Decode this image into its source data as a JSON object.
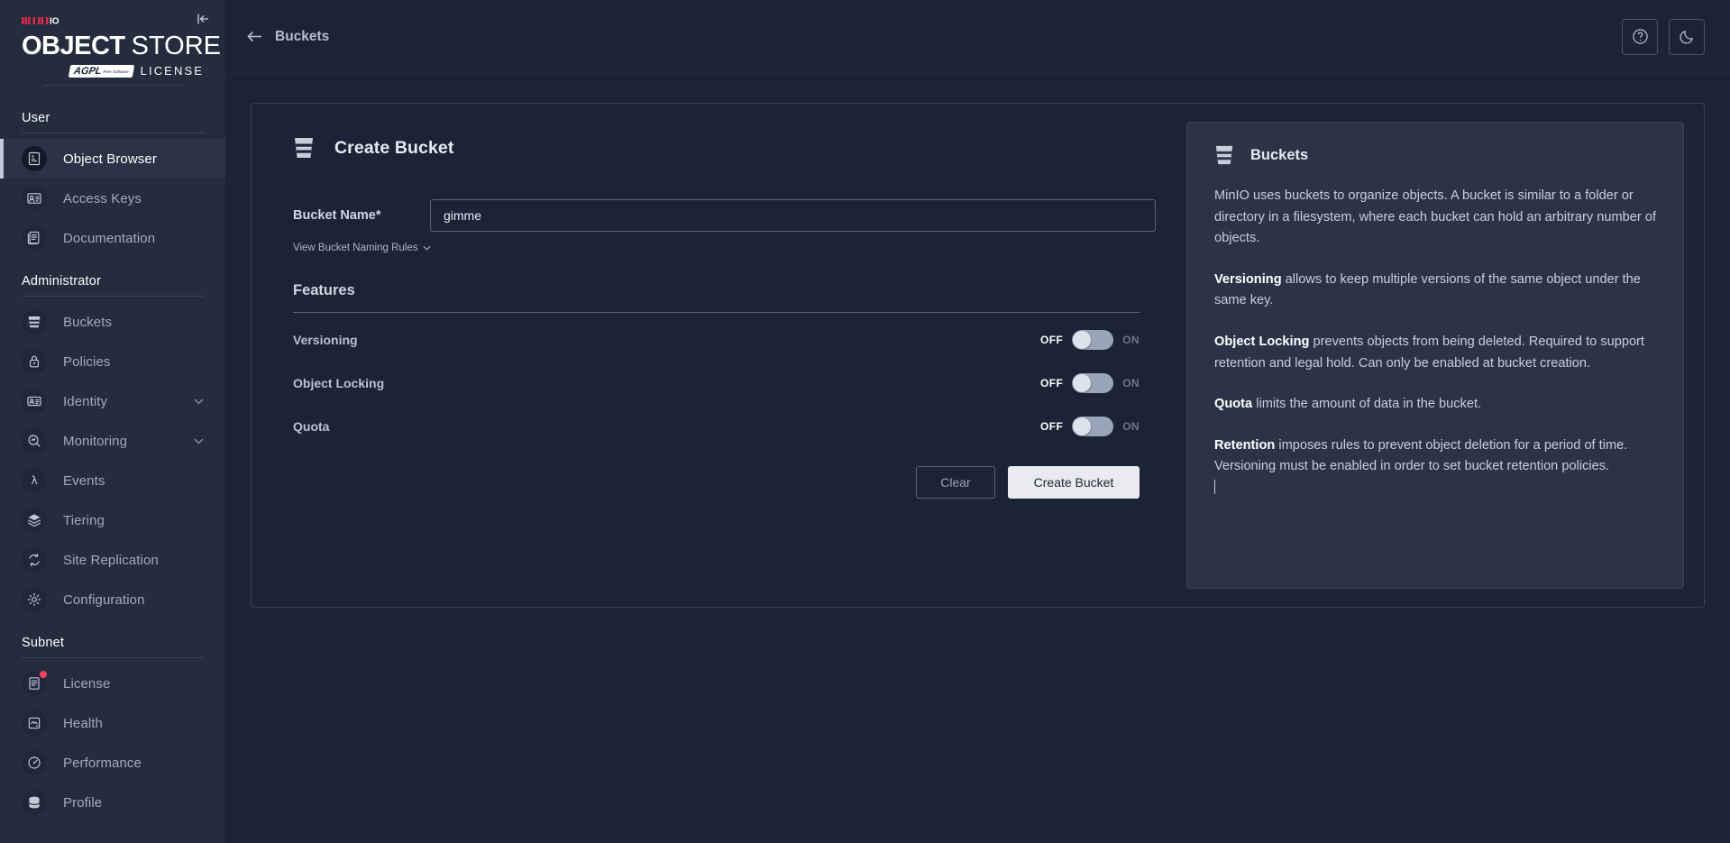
{
  "brand": {
    "minio": "MINIO",
    "object": "OBJECT",
    "store": "STORE",
    "agpl": "AGPL",
    "agpl_sub": "Free Software",
    "license": "LICENSE",
    "collapse_icon": "collapse-sidebar-icon"
  },
  "sidebar": {
    "sections": [
      {
        "title": "User",
        "items": [
          {
            "label": "Object Browser",
            "icon": "object-browser-icon",
            "active": true,
            "expandable": false,
            "badge": false
          },
          {
            "label": "Access Keys",
            "icon": "access-keys-icon",
            "active": false,
            "expandable": false,
            "badge": false
          },
          {
            "label": "Documentation",
            "icon": "documentation-icon",
            "active": false,
            "expandable": false,
            "badge": false
          }
        ]
      },
      {
        "title": "Administrator",
        "items": [
          {
            "label": "Buckets",
            "icon": "bucket-icon",
            "active": false,
            "expandable": false,
            "badge": false
          },
          {
            "label": "Policies",
            "icon": "policies-lock-icon",
            "active": false,
            "expandable": false,
            "badge": false
          },
          {
            "label": "Identity",
            "icon": "identity-card-icon",
            "active": false,
            "expandable": true,
            "badge": false
          },
          {
            "label": "Monitoring",
            "icon": "monitoring-magnifier-icon",
            "active": false,
            "expandable": true,
            "badge": false
          },
          {
            "label": "Events",
            "icon": "events-lambda-icon",
            "active": false,
            "expandable": false,
            "badge": false
          },
          {
            "label": "Tiering",
            "icon": "tiering-layers-icon",
            "active": false,
            "expandable": false,
            "badge": false
          },
          {
            "label": "Site Replication",
            "icon": "site-replication-icon",
            "active": false,
            "expandable": false,
            "badge": false
          },
          {
            "label": "Configuration",
            "icon": "gear-icon",
            "active": false,
            "expandable": false,
            "badge": false
          }
        ]
      },
      {
        "title": "Subnet",
        "items": [
          {
            "label": "License",
            "icon": "license-doc-icon",
            "active": false,
            "expandable": false,
            "badge": true
          },
          {
            "label": "Health",
            "icon": "health-icon",
            "active": false,
            "expandable": false,
            "badge": false
          },
          {
            "label": "Performance",
            "icon": "performance-gauge-icon",
            "active": false,
            "expandable": false,
            "badge": false
          },
          {
            "label": "Profile",
            "icon": "profile-stack-icon",
            "active": false,
            "expandable": false,
            "badge": false
          }
        ]
      }
    ]
  },
  "topbar": {
    "back_icon": "arrow-left-icon",
    "breadcrumb": "Buckets",
    "help_icon": "help-circle-icon",
    "theme_icon": "moon-icon"
  },
  "form": {
    "icon": "bucket-icon",
    "title": "Create Bucket",
    "bucket_name_label": "Bucket Name*",
    "bucket_name_value": "gimme",
    "bucket_name_placeholder": "",
    "naming_rules_label": "View Bucket Naming Rules",
    "naming_rules_chevron": "chevron-down-icon",
    "features_heading": "Features",
    "features": [
      {
        "name": "Versioning",
        "off_label": "OFF",
        "on_label": "ON",
        "state": "off"
      },
      {
        "name": "Object Locking",
        "off_label": "OFF",
        "on_label": "ON",
        "state": "off"
      },
      {
        "name": "Quota",
        "off_label": "OFF",
        "on_label": "ON",
        "state": "off"
      }
    ],
    "clear_label": "Clear",
    "create_label": "Create Bucket"
  },
  "help": {
    "icon": "bucket-icon",
    "title": "Buckets",
    "paragraphs": [
      {
        "bold": "",
        "text": "MinIO uses buckets to organize objects. A bucket is similar to a folder or directory in a filesystem, where each bucket can hold an arbitrary number of objects."
      },
      {
        "bold": "Versioning",
        "text": " allows to keep multiple versions of the same object under the same key."
      },
      {
        "bold": "Object Locking",
        "text": " prevents objects from being deleted. Required to support retention and legal hold. Can only be enabled at bucket creation."
      },
      {
        "bold": "Quota",
        "text": " limits the amount of data in the bucket."
      },
      {
        "bold": "Retention",
        "text": " imposes rules to prevent object deletion for a period of time. Versioning must be enabled in order to set bucket retention policies."
      }
    ],
    "has_caret": true
  },
  "colors": {
    "sidebar_bg": "#242c3e",
    "main_bg": "#1b2436",
    "help_bg": "#2b3447",
    "accent_red": "#f0415f",
    "primary_btn": "#e9ebee",
    "border": "#39415a"
  }
}
